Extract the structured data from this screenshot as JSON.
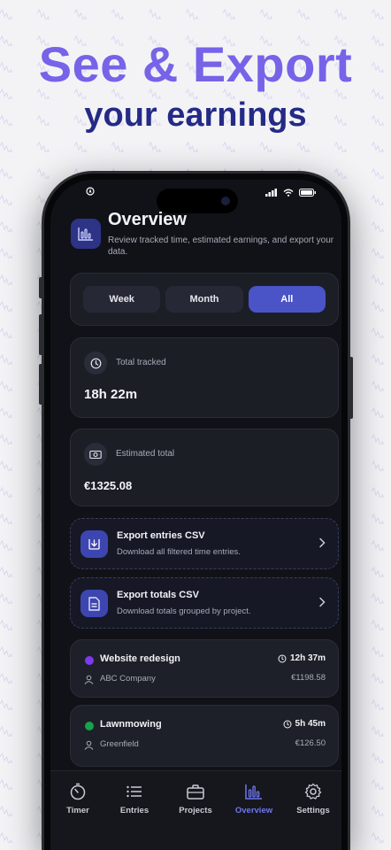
{
  "headline": {
    "line1": "See & Export",
    "line2": "your earnings"
  },
  "colors": {
    "accent": "#7663e8",
    "navy": "#242a86",
    "active_tab": "#6f77ee",
    "segment_active": "#4a54c7"
  },
  "status_bar": {
    "icons": [
      "location-arrow-icon",
      "signal-icon",
      "wifi-icon",
      "battery-icon"
    ]
  },
  "header": {
    "title": "Overview",
    "subtitle": "Review tracked time, estimated earnings, and export your data.",
    "icon": "bar-chart-icon"
  },
  "range_selector": {
    "options": [
      "Week",
      "Month",
      "All"
    ],
    "selected": "All"
  },
  "stats": {
    "total_tracked": {
      "label": "Total tracked",
      "value": "18h 22m",
      "icon": "clock-icon"
    },
    "estimated_total": {
      "label": "Estimated total",
      "value": "€1325.08",
      "icon": "money-icon"
    }
  },
  "exports": [
    {
      "title": "Export entries CSV",
      "subtitle": "Download all filtered time entries.",
      "icon": "download-icon"
    },
    {
      "title": "Export totals CSV",
      "subtitle": "Download totals grouped by project.",
      "icon": "document-icon"
    }
  ],
  "projects": [
    {
      "name": "Website redesign",
      "client": "ABC Company",
      "time": "12h 37m",
      "amount": "€1198.58",
      "color": "#7c3aed"
    },
    {
      "name": "Lawnmowing",
      "client": "Greenfield",
      "time": "5h 45m",
      "amount": "€126.50",
      "color": "#16a34a"
    }
  ],
  "tabs": [
    {
      "label": "Timer",
      "icon": "stopwatch-icon"
    },
    {
      "label": "Entries",
      "icon": "list-icon"
    },
    {
      "label": "Projects",
      "icon": "briefcase-icon"
    },
    {
      "label": "Overview",
      "icon": "bar-chart-icon"
    },
    {
      "label": "Settings",
      "icon": "gear-icon"
    }
  ],
  "active_tab": "Overview"
}
